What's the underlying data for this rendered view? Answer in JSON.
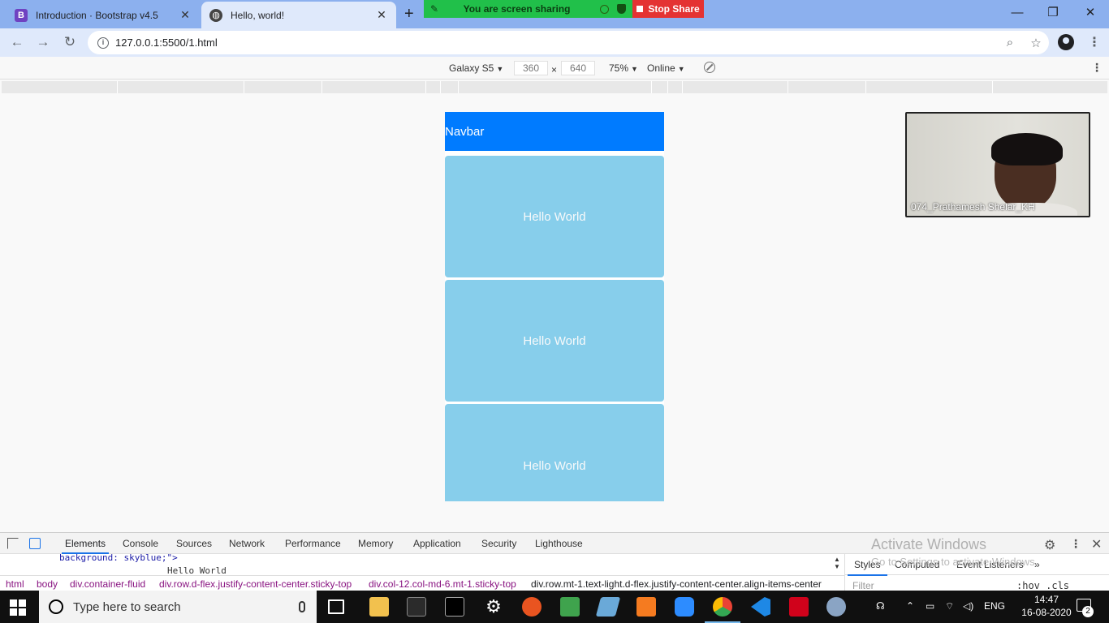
{
  "browser": {
    "tabs": [
      {
        "title": "Introduction · Bootstrap v4.5",
        "favicon": "bootstrap-icon",
        "active": false
      },
      {
        "title": "Hello, world!",
        "favicon": "globe-icon",
        "active": true
      }
    ],
    "new_tab": "+",
    "screen_share": {
      "status": "You are screen sharing",
      "stop_label": "Stop Share"
    },
    "window_controls": {
      "minimize": "—",
      "restore": "❐",
      "close": "✕"
    },
    "url": "127.0.0.1:5500/1.html"
  },
  "device_toolbar": {
    "device": "Galaxy S5",
    "width": "360",
    "height": "640",
    "times": "×",
    "zoom": "75%",
    "network": "Online"
  },
  "page": {
    "navbar": "Navbar",
    "boxes": [
      "Hello World",
      "Hello World",
      "Hello World"
    ],
    "box_color": "#87ceeb",
    "navbar_color": "#007bff"
  },
  "video_call": {
    "participant": "074_Prathamesh Shelar_KH"
  },
  "devtools": {
    "tabs": [
      "Elements",
      "Console",
      "Sources",
      "Network",
      "Performance",
      "Memory",
      "Application",
      "Security",
      "Lighthouse"
    ],
    "code_line_1": "background: skyblue;\">",
    "code_line_2": "Hello World",
    "breadcrumbs": [
      "html",
      "body",
      "div.container-fluid",
      "div.row.d-flex.justify-content-center.sticky-top",
      "div.col-12.col-md-6.mt-1.sticky-top",
      "div.row.mt-1.text-light.d-flex.justify-content-center.align-items-center"
    ],
    "styles_tabs": [
      "Styles",
      "Computed",
      "Event Listeners"
    ],
    "more": "»",
    "filter_placeholder": "Filter",
    "hov_cls": ":hov .cls",
    "watermark_line1": "Activate Windows",
    "watermark_line2": "Go to Settings to activate Windows."
  },
  "taskbar": {
    "search_placeholder": "Type here to search",
    "language": "ENG",
    "time": "14:47",
    "date": "16-08-2020",
    "notification_count": "2"
  }
}
